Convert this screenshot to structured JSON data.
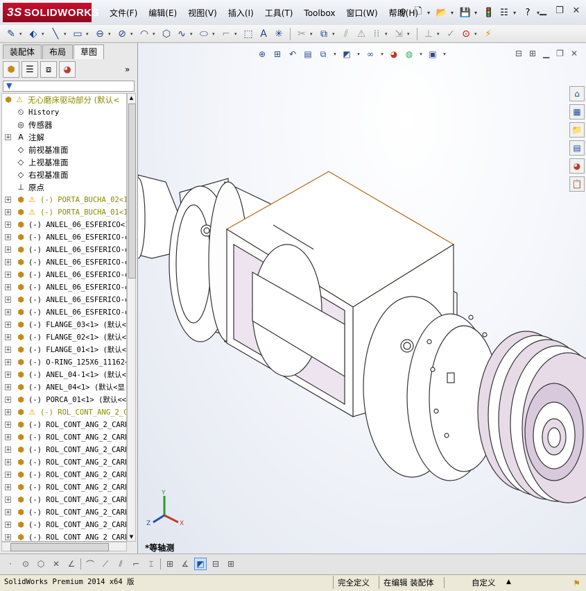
{
  "app": {
    "logo_text": "SOLIDWORKS",
    "logo_prefix": "3S",
    "menus": [
      "文件(F)",
      "编辑(E)",
      "视图(V)",
      "插入(I)",
      "工具(T)",
      "Toolbox",
      "窗口(W)",
      "帮助(H)"
    ],
    "title_icons": [
      "pin-icon",
      "new-document-icon",
      "open-folder-icon",
      "save-icon",
      "rebuild-icon",
      "options-icon",
      "help-icon"
    ],
    "window_controls": [
      "minimize-icon",
      "restore-icon",
      "close-icon"
    ]
  },
  "command_toolbar": {
    "icons": [
      "sketch-icon",
      "smart-dimension-icon",
      "line-icon",
      "rectangle-icon",
      "slot-icon",
      "circle-icon",
      "arc-icon",
      "spline-icon",
      "ellipse-icon",
      "fillet-icon",
      "plane-icon",
      "text-icon",
      "point-icon",
      "trim-icon",
      "convert-entities-icon",
      "offset-icon",
      "mirror-icon",
      "linear-pattern-icon",
      "move-icon",
      "display-relations-icon",
      "repair-icon",
      "quick-snaps-icon",
      "rapid-sketch-icon"
    ]
  },
  "left_panel": {
    "tabs": [
      {
        "label": "装配体",
        "active": false
      },
      {
        "label": "布局",
        "active": false
      },
      {
        "label": "草图",
        "active": true
      }
    ],
    "manager_tabs": [
      "feature-manager-icon",
      "property-manager-icon",
      "configuration-manager-icon",
      "appearance-manager-icon"
    ],
    "more_icon": "»",
    "filter_icon": "▼",
    "tree": [
      {
        "label": "无心磨床驱动部分  (默认<",
        "icon": "assembly-icon",
        "warning": true,
        "expand": "",
        "color": "olive",
        "cn": true
      },
      {
        "label": "History",
        "icon": "history-icon",
        "warning": false,
        "expand": "",
        "color": "black",
        "cn": false
      },
      {
        "label": "传感器",
        "icon": "sensor-icon",
        "warning": false,
        "expand": "",
        "color": "black",
        "cn": true
      },
      {
        "label": "注解",
        "icon": "annotation-icon",
        "warning": false,
        "expand": "+",
        "color": "black",
        "cn": true
      },
      {
        "label": "前视基准面",
        "icon": "plane-icon",
        "warning": false,
        "expand": "",
        "color": "black",
        "cn": true
      },
      {
        "label": "上视基准面",
        "icon": "plane-icon",
        "warning": false,
        "expand": "",
        "color": "black",
        "cn": true
      },
      {
        "label": "右视基准面",
        "icon": "plane-icon",
        "warning": false,
        "expand": "",
        "color": "black",
        "cn": true
      },
      {
        "label": "原点",
        "icon": "origin-icon",
        "warning": false,
        "expand": "",
        "color": "black",
        "cn": true
      },
      {
        "label": "(-) PORTA_BUCHA_02<1",
        "icon": "part-icon",
        "warning": true,
        "expand": "+",
        "color": "olive",
        "cn": false
      },
      {
        "label": "(-) PORTA_BUCHA_01<1",
        "icon": "part-icon",
        "warning": true,
        "expand": "+",
        "color": "olive",
        "cn": false
      },
      {
        "label": "(-) ANLEL_06_ESFERICO<1",
        "icon": "part-icon",
        "warning": false,
        "expand": "+",
        "color": "black",
        "cn": false
      },
      {
        "label": "(-) ANLEL_06_ESFERICO-o",
        "icon": "part-icon",
        "warning": false,
        "expand": "+",
        "color": "black",
        "cn": false
      },
      {
        "label": "(-) ANLEL_06_ESFERICO-o",
        "icon": "part-icon",
        "warning": false,
        "expand": "+",
        "color": "black",
        "cn": false
      },
      {
        "label": "(-) ANLEL_06_ESFERICO-o",
        "icon": "part-icon",
        "warning": false,
        "expand": "+",
        "color": "black",
        "cn": false
      },
      {
        "label": "(-) ANLEL_06_ESFERICO-o",
        "icon": "part-icon",
        "warning": false,
        "expand": "+",
        "color": "black",
        "cn": false
      },
      {
        "label": "(-) ANLEL_06_ESFERICO-o",
        "icon": "part-icon",
        "warning": false,
        "expand": "+",
        "color": "black",
        "cn": false
      },
      {
        "label": "(-) ANLEL_06_ESFERICO-o",
        "icon": "part-icon",
        "warning": false,
        "expand": "+",
        "color": "black",
        "cn": false
      },
      {
        "label": "(-) ANLEL_06_ESFERICO-o",
        "icon": "part-icon",
        "warning": false,
        "expand": "+",
        "color": "black",
        "cn": false
      },
      {
        "label": "(-) FLANGE_03<1> (默认<",
        "icon": "part-icon",
        "warning": false,
        "expand": "+",
        "color": "black",
        "cn": false
      },
      {
        "label": "(-) FLANGE_02<1> (默认<",
        "icon": "part-icon",
        "warning": false,
        "expand": "+",
        "color": "black",
        "cn": false
      },
      {
        "label": "(-) FLANGE_01<1> (默认<",
        "icon": "part-icon",
        "warning": false,
        "expand": "+",
        "color": "black",
        "cn": false
      },
      {
        "label": "(-) O-RING_125X6_11162<",
        "icon": "part-icon",
        "warning": false,
        "expand": "+",
        "color": "black",
        "cn": false
      },
      {
        "label": "(-) ANEL_04-1<1> (默认<",
        "icon": "part-icon",
        "warning": false,
        "expand": "+",
        "color": "black",
        "cn": false
      },
      {
        "label": "(-) ANEL_04<1> (默认<显",
        "icon": "part-icon",
        "warning": false,
        "expand": "+",
        "color": "black",
        "cn": false
      },
      {
        "label": "(-) PORCA_01<1> (默认<<",
        "icon": "part-icon",
        "warning": false,
        "expand": "+",
        "color": "black",
        "cn": false
      },
      {
        "label": "(-) ROL_CONT_ANG_2_C",
        "icon": "part-icon",
        "warning": true,
        "expand": "+",
        "color": "olive",
        "cn": false
      },
      {
        "label": "(-) ROL_CONT_ANG_2_CARR",
        "icon": "part-icon",
        "warning": false,
        "expand": "+",
        "color": "black",
        "cn": false
      },
      {
        "label": "(-) ROL_CONT_ANG_2_CARR",
        "icon": "part-icon",
        "warning": false,
        "expand": "+",
        "color": "black",
        "cn": false
      },
      {
        "label": "(-) ROL_CONT_ANG_2_CARR",
        "icon": "part-icon",
        "warning": false,
        "expand": "+",
        "color": "black",
        "cn": false
      },
      {
        "label": "(-) ROL_CONT_ANG_2_CARR",
        "icon": "part-icon",
        "warning": false,
        "expand": "+",
        "color": "black",
        "cn": false
      },
      {
        "label": "(-) ROL_CONT_ANG_2_CARR",
        "icon": "part-icon",
        "warning": false,
        "expand": "+",
        "color": "black",
        "cn": false
      },
      {
        "label": "(-) ROL_CONT_ANG_2_CARR",
        "icon": "part-icon",
        "warning": false,
        "expand": "+",
        "color": "black",
        "cn": false
      },
      {
        "label": "(-) ROL_CONT_ANG_2_CARR",
        "icon": "part-icon",
        "warning": false,
        "expand": "+",
        "color": "black",
        "cn": false
      },
      {
        "label": "(-) ROL_CONT_ANG_2_CARR",
        "icon": "part-icon",
        "warning": false,
        "expand": "+",
        "color": "black",
        "cn": false
      },
      {
        "label": "(-) ROL_CONT_ANG_2_CARR",
        "icon": "part-icon",
        "warning": false,
        "expand": "+",
        "color": "black",
        "cn": false
      },
      {
        "label": "(-) ROL_CONT_ANG_2_CARR",
        "icon": "part-icon",
        "warning": false,
        "expand": "+",
        "color": "black",
        "cn": false
      }
    ]
  },
  "viewport": {
    "view_name": "*等轴测",
    "triad": {
      "x": "X",
      "y": "Y",
      "z": "Z"
    },
    "headsup_icons": [
      "zoom-to-fit-icon",
      "zoom-to-area-icon",
      "previous-view-icon",
      "section-view-icon",
      "view-orientation-icon",
      "display-style-icon",
      "hide-show-items-icon",
      "edit-appearance-icon",
      "apply-scene-icon",
      "view-settings-icon"
    ],
    "task_pane_icons": [
      "home-icon",
      "design-library-icon",
      "file-explorer-icon",
      "view-palette-icon",
      "appearances-icon",
      "custom-properties-icon"
    ],
    "controls": [
      "split-horizontal-icon",
      "split-vertical-icon",
      "minimize-icon",
      "restore-icon",
      "close-icon"
    ]
  },
  "view_toolbar": {
    "icons": [
      "point-icon",
      "circle-icon",
      "polygon-icon",
      "trim-icon",
      "extend-icon",
      "line-icon",
      "centerline-icon",
      "construction-icon",
      "sketch-fillet-icon",
      "dimension-icon",
      "grid-icon",
      "angle-icon",
      "shaded-view-icon",
      "horizontal-split-icon",
      "four-view-icon"
    ],
    "selected": "shaded-view-icon"
  },
  "status": {
    "product": "SolidWorks Premium 2014 x64 版",
    "definition": "完全定义",
    "editing": "在编辑 装配体",
    "units": "自定义",
    "units_arrow": "▲"
  },
  "colors": {
    "accent_red": "#c8102e",
    "olive_text": "#8a8a00",
    "part_yellow": "#c28b1c"
  }
}
